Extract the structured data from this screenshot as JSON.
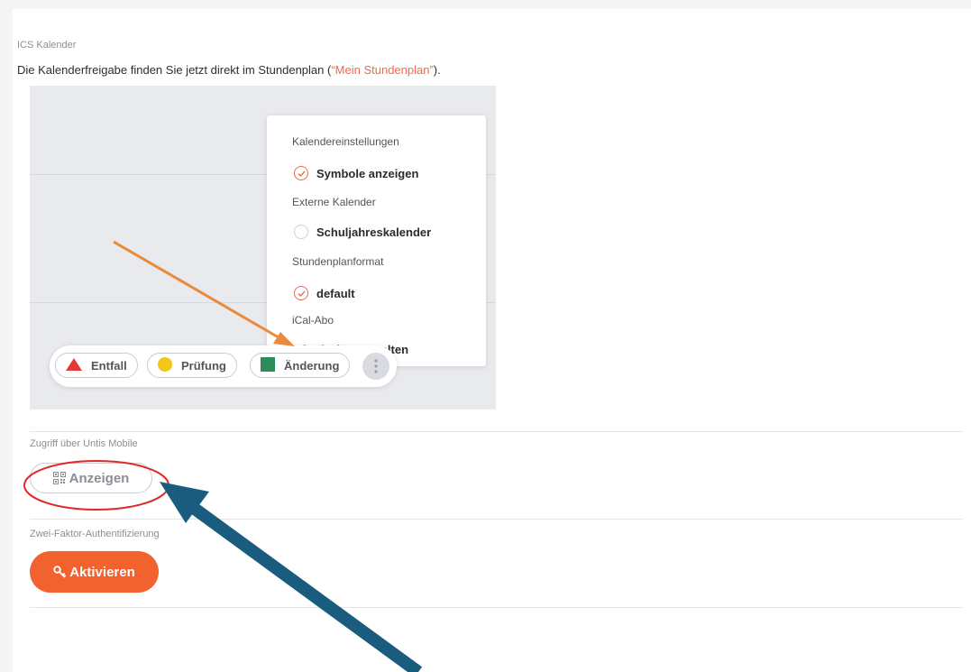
{
  "ics": {
    "section_title": "ICS Kalender",
    "desc_prefix": "Die Kalenderfreigabe finden Sie jetzt direkt im Stundenplan (",
    "desc_link": "“Mein Stundenplan”",
    "desc_suffix": ")."
  },
  "screenshot": {
    "menu": {
      "calendar_settings_label": "Kalendereinstellungen",
      "show_symbols": "Symbole anzeigen",
      "external_calendars_label": "Externe Kalender",
      "school_year_calendar": "Schuljahreskalender",
      "timetable_format_label": "Stundenplanformat",
      "format_default": "default",
      "ical_label": "iCal-Abo",
      "ical_manage": "iCal-Abo verwalten"
    },
    "legend": {
      "cancelled": "Entfall",
      "exam": "Prüfung",
      "change": "Änderung"
    }
  },
  "mobile": {
    "section_title": "Zugriff über Untis Mobile",
    "show_button": "Anzeigen"
  },
  "twofa": {
    "section_title": "Zwei-Faktor-Authentifizierung",
    "activate_button": "Aktivieren"
  },
  "colors": {
    "accent": "#f2622f",
    "link": "#f06a4a",
    "arrow_orange": "#ea8a3a",
    "arrow_blue": "#1a5c7e",
    "highlight_red": "#e0282a",
    "legend_red": "#e53935",
    "legend_yellow": "#f5c518",
    "legend_green": "#2e8b57"
  },
  "icons": {
    "check": "check-circle-icon",
    "radio": "empty-radio-icon",
    "qr": "qr-code-icon",
    "key": "key-icon",
    "more": "vertical-dots-icon"
  }
}
